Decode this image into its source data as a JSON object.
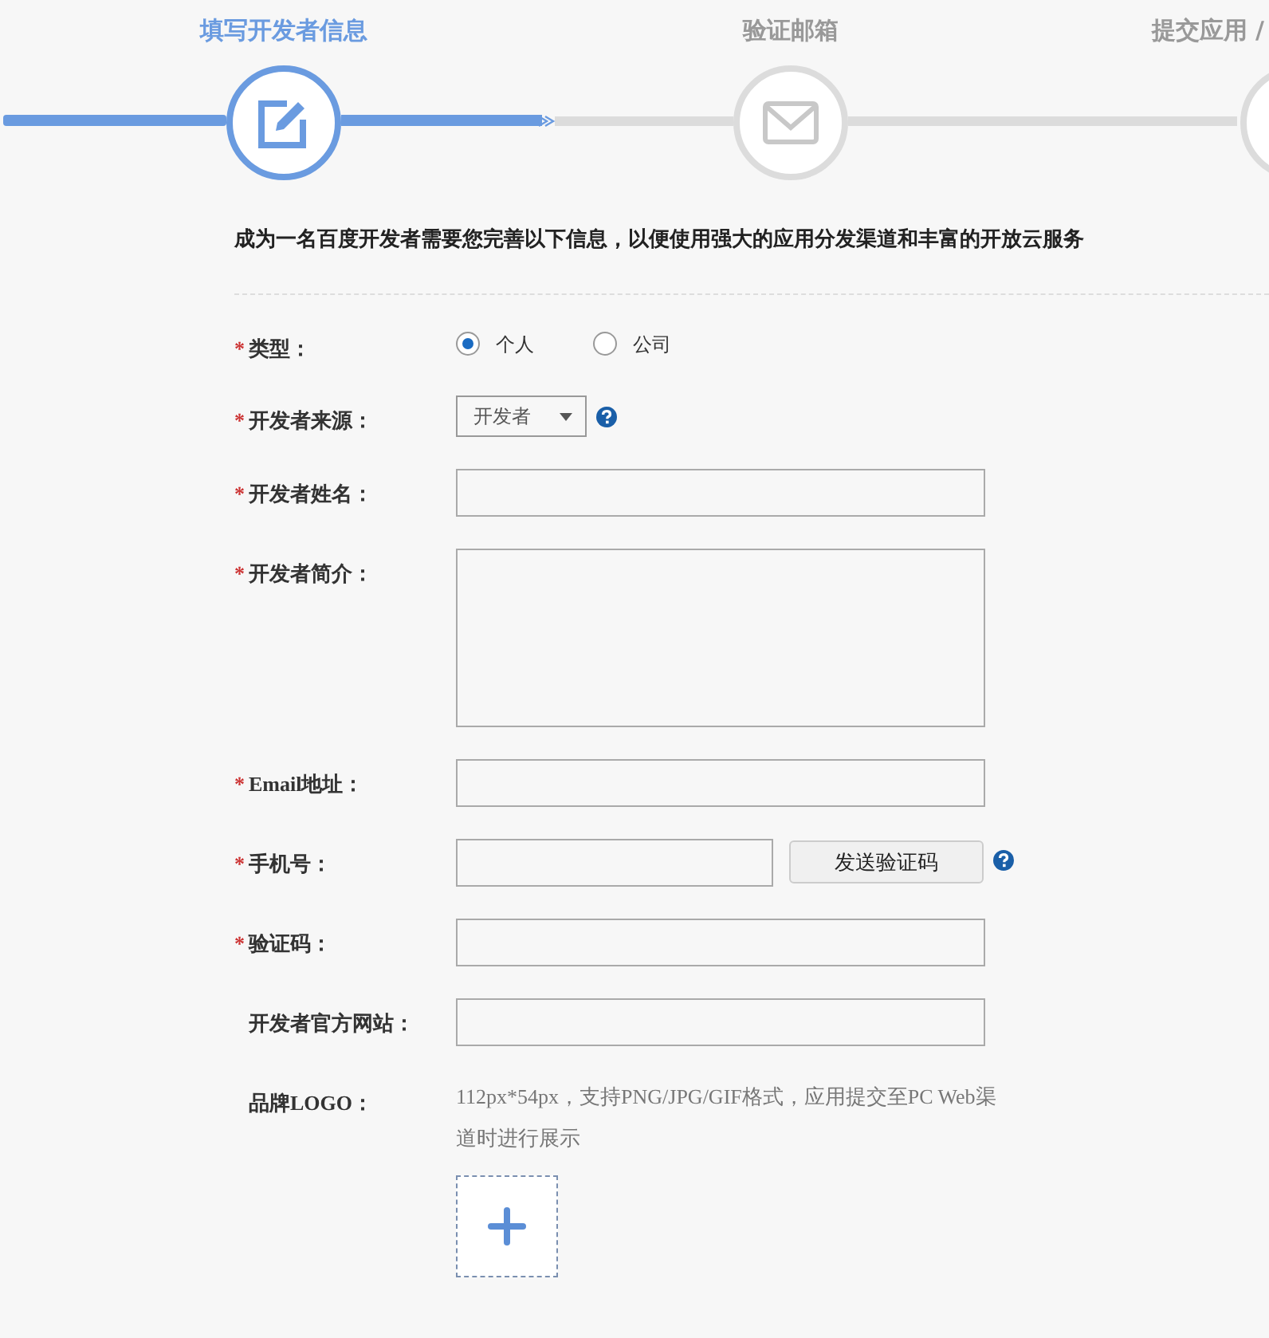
{
  "steps": [
    {
      "label": "填写开发者信息",
      "selected": true
    },
    {
      "label": "验证邮箱",
      "selected": false
    },
    {
      "label": "提交应用 /",
      "selected": false
    }
  ],
  "intro": "成为一名百度开发者需要您完善以下信息，以便使用强大的应用分发渠道和丰富的开放云服务",
  "fields": [
    {
      "kind": "radio",
      "asterisk": "*",
      "label": "类型：",
      "options": [
        {
          "label": "个人",
          "selected": true
        },
        {
          "label": "公司",
          "selected": false
        }
      ]
    },
    {
      "kind": "select",
      "asterisk": "*",
      "label": "开发者来源：",
      "value": "开发者",
      "help": true
    },
    {
      "kind": "text",
      "asterisk": "*",
      "label": "开发者姓名："
    },
    {
      "kind": "textarea",
      "asterisk": "*",
      "label": "开发者简介："
    },
    {
      "kind": "text",
      "asterisk": "*",
      "label": "Email地址："
    },
    {
      "kind": "phone",
      "asterisk": "*",
      "label": "手机号：",
      "button": "发送验证码",
      "help": true
    },
    {
      "kind": "text",
      "asterisk": "*",
      "label": "验证码："
    },
    {
      "kind": "text",
      "label": "开发者官方网站："
    },
    {
      "kind": "logo",
      "label": "品牌LOGO：",
      "hint": "112px*54px，支持PNG/JPG/GIF格式，应用提交至PC Web渠道时进行展示"
    }
  ]
}
